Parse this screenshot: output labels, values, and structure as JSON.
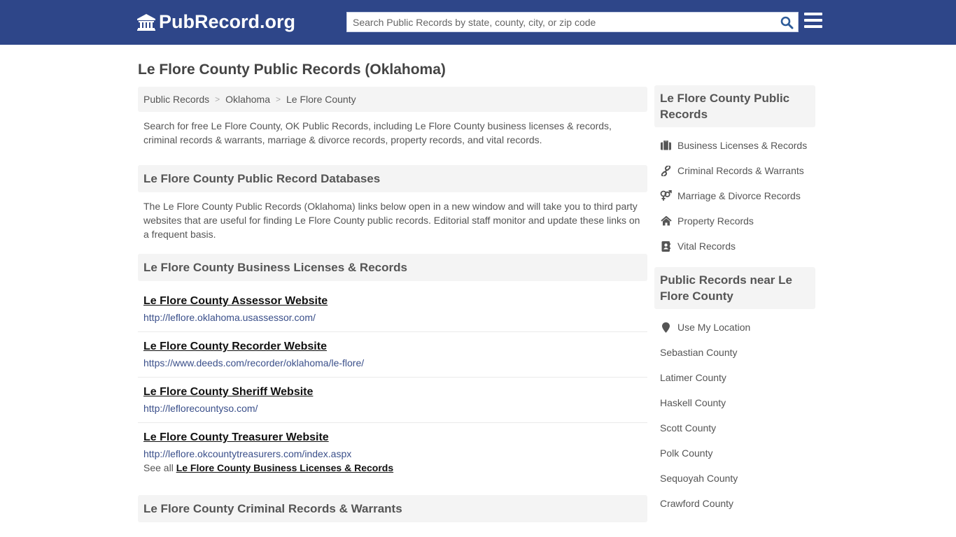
{
  "header": {
    "logo_text": "PubRecord.org",
    "logo_icon": "courthouse-icon",
    "search_placeholder": "Search Public Records by state, county, city, or zip code",
    "search_value": "",
    "search_icon": "search-icon",
    "menu_icon": "hamburger-menu-icon",
    "brand_color": "#2e4689"
  },
  "page": {
    "title": "Le Flore County Public Records (Oklahoma)"
  },
  "breadcrumb": {
    "items": [
      "Public Records",
      "Oklahoma",
      "Le Flore County"
    ],
    "separator": ">"
  },
  "intro": "Search for free Le Flore County, OK Public Records, including Le Flore County business licenses & records, criminal records & warrants, marriage & divorce records, property records, and vital records.",
  "databases": {
    "heading": "Le Flore County Public Record Databases",
    "description": "The Le Flore County Public Records (Oklahoma) links below open in a new window and will take you to third party websites that are useful for finding Le Flore County public records. Editorial staff monitor and update these links on a frequent basis."
  },
  "business": {
    "heading": "Le Flore County Business Licenses & Records",
    "links": [
      {
        "title": "Le Flore County Assessor Website",
        "url": "http://leflore.oklahoma.usassessor.com/"
      },
      {
        "title": "Le Flore County Recorder Website",
        "url": "https://www.deeds.com/recorder/oklahoma/le-flore/"
      },
      {
        "title": "Le Flore County Sheriff Website",
        "url": "http://leflorecountyso.com/"
      },
      {
        "title": "Le Flore County Treasurer Website",
        "url": "http://leflore.okcountytreasurers.com/index.aspx"
      }
    ],
    "see_all_prefix": "See all",
    "see_all_link": "Le Flore County Business Licenses & Records"
  },
  "criminal": {
    "heading": "Le Flore County Criminal Records & Warrants"
  },
  "sidebar": {
    "records_heading": "Le Flore County Public Records",
    "records_items": [
      {
        "label": "Business Licenses & Records",
        "icon": "briefcase-icon"
      },
      {
        "label": "Criminal Records & Warrants",
        "icon": "link-icon"
      },
      {
        "label": "Marriage & Divorce Records",
        "icon": "venus-mars-icon"
      },
      {
        "label": "Property Records",
        "icon": "home-icon"
      },
      {
        "label": "Vital Records",
        "icon": "contact-book-icon"
      }
    ],
    "near_heading": "Public Records near Le Flore County",
    "use_location": "Use My Location",
    "near_items": [
      "Sebastian County",
      "Latimer County",
      "Haskell County",
      "Scott County",
      "Polk County",
      "Sequoyah County",
      "Crawford County"
    ]
  }
}
